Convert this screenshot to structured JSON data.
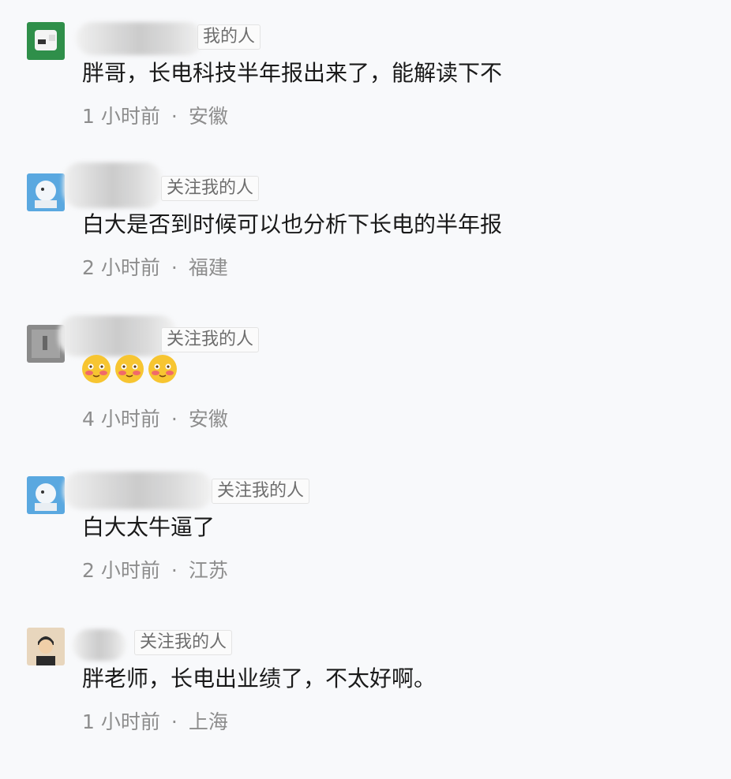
{
  "comments": [
    {
      "follow_label": "我的人",
      "text": "胖哥，长电科技半年报出来了，能解读下不",
      "time": "1 小时前",
      "separator": "·",
      "location": "安徽"
    },
    {
      "follow_label": "关注我的人",
      "text": "白大是否到时候可以也分析下长电的半年报",
      "time": "2 小时前",
      "separator": "·",
      "location": "福建"
    },
    {
      "follow_label": "关注我的人",
      "emoji_icons": [
        "blush-face-icon",
        "blush-face-icon",
        "blush-face-icon"
      ],
      "time": "4 小时前",
      "separator": "·",
      "location": "安徽"
    },
    {
      "follow_label": "关注我的人",
      "text": "白大太牛逼了",
      "time": "2 小时前",
      "separator": "·",
      "location": "江苏"
    },
    {
      "follow_label": "关注我的人",
      "text": "胖老师，长电出业绩了，不太好啊。",
      "time": "1 小时前",
      "separator": "·",
      "location": "上海"
    }
  ]
}
